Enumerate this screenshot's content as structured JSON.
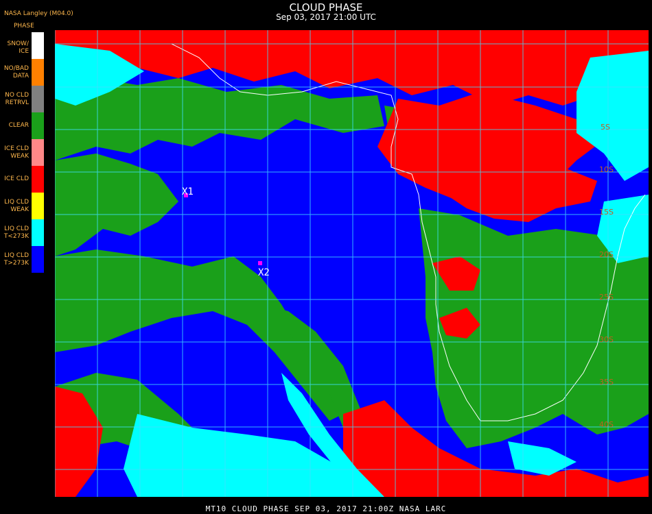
{
  "header": {
    "title": "CLOUD PHASE",
    "subtitle": "Sep 03, 2017 21:00 UTC",
    "provider": "NASA Langley (M04.0)"
  },
  "legend": {
    "title": "PHASE",
    "items": [
      {
        "label": "SNOW/\nICE",
        "color": "#ffffff"
      },
      {
        "label": "NO/BAD\nDATA",
        "color": "#ff8000"
      },
      {
        "label": "NO CLD\nRETRVL",
        "color": "#808080"
      },
      {
        "label": "CLEAR",
        "color": "#1aa01a"
      },
      {
        "label": "ICE CLD\nWEAK",
        "color": "#ff8888"
      },
      {
        "label": "ICE CLD",
        "color": "#ff0000"
      },
      {
        "label": "LIQ CLD\nWEAK",
        "color": "#ffff00"
      },
      {
        "label": "LIQ CLD\nT<273K",
        "color": "#00ffff"
      },
      {
        "label": "LIQ CLD\nT>273K",
        "color": "#0000ff"
      }
    ]
  },
  "markers": [
    {
      "label": "X1"
    },
    {
      "label": "X2"
    }
  ],
  "lat_labels": [
    "5S",
    "10S",
    "15S",
    "20S",
    "25S",
    "30S",
    "35S",
    "40S"
  ],
  "footer": "MT10  CLOUD PHASE   SEP 03, 2017 21:00Z   NASA LARC"
}
